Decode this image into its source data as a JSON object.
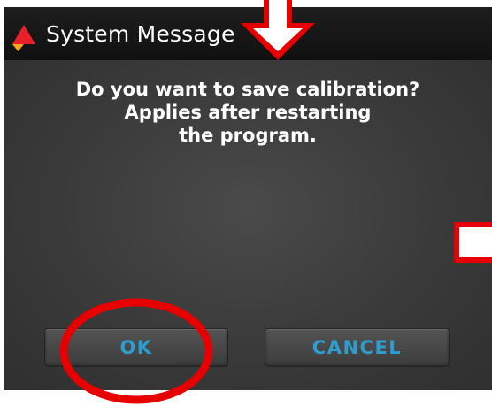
{
  "dialog": {
    "title": "System Message",
    "icon": "warning-triangle-icon",
    "message_lines": [
      "Do you want to save calibration?",
      "Applies after restarting",
      "the program."
    ],
    "ok_label": "OK",
    "cancel_label": "CANCEL"
  },
  "colors": {
    "title_bar": "#121212",
    "dialog_background": "#3b3b3b",
    "message_text": "#ffffff",
    "button_text": "#2d9ccf",
    "icon_red": "#e8202a",
    "icon_orange": "#f5a623",
    "annotation_red": "#e60000"
  },
  "annotations": {
    "arrow": "down-arrow-icon",
    "circle": "highlight-circle",
    "marker": "red-square-marker"
  }
}
